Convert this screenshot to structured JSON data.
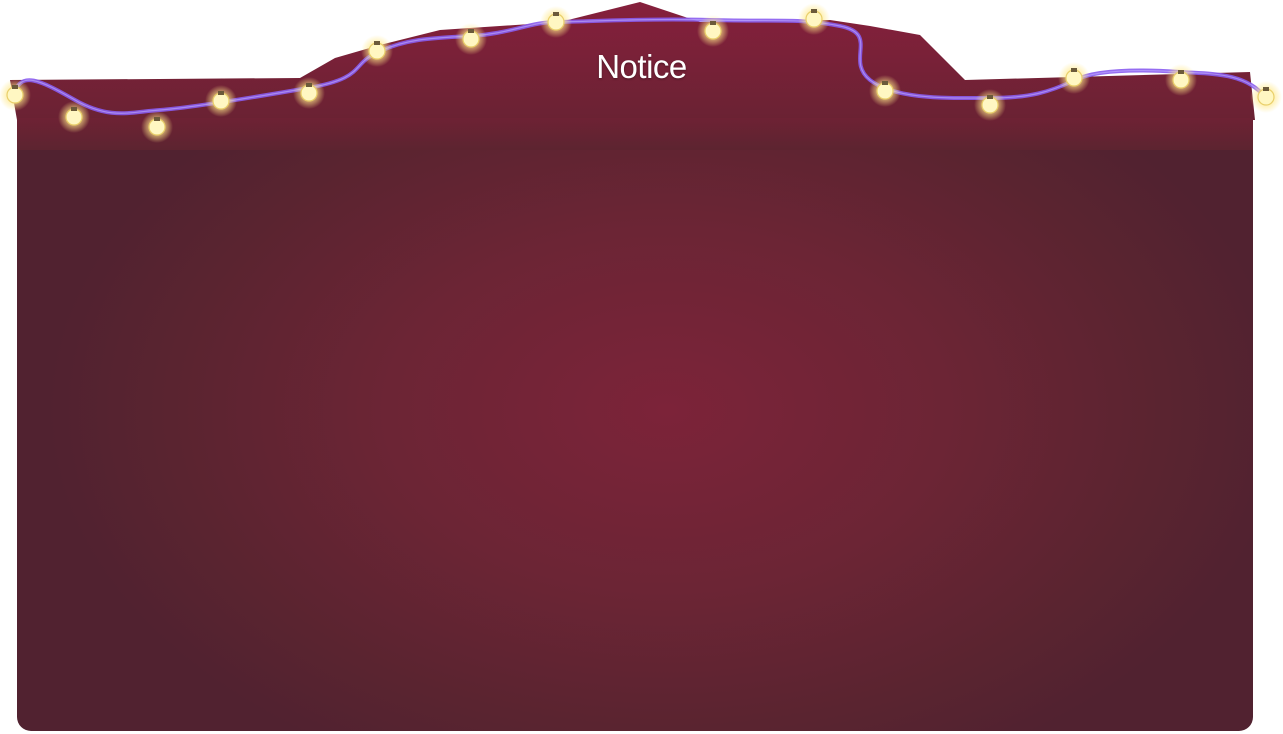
{
  "dialog": {
    "title": "Notice",
    "message": ""
  },
  "colors": {
    "panel": "#6c2535",
    "panel_top": "#7a1e36",
    "wire": "#8a5cf0",
    "bulb": "#fff7c2",
    "bulb_glow": "#ffe98a"
  },
  "icons": {
    "lights": "string-lights-icon",
    "bulb": "light-bulb-icon"
  }
}
